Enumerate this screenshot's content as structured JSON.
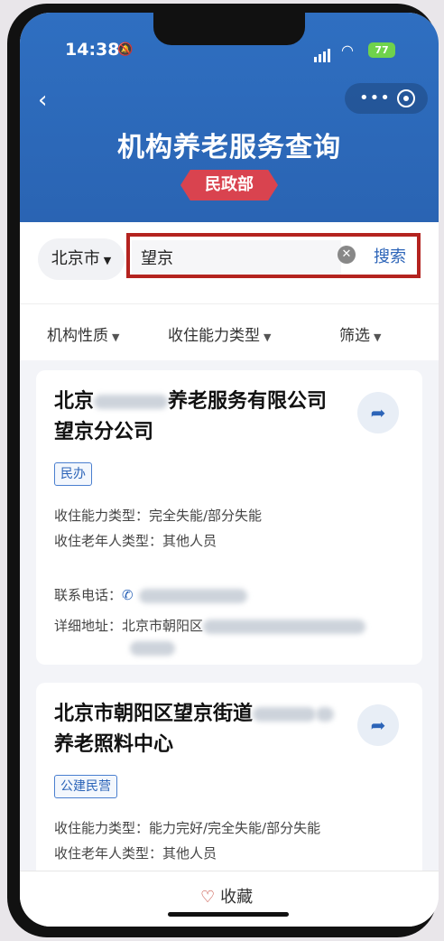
{
  "status": {
    "time": "14:38",
    "battery": "77"
  },
  "header": {
    "title": "机构养老服务查询",
    "ribbon": "民政部"
  },
  "search": {
    "city": "北京市",
    "query": "望京",
    "button": "搜索"
  },
  "filters": [
    "机构性质",
    "收住能力类型",
    "筛选"
  ],
  "cards": [
    {
      "title_prefix": "北京",
      "title_suffix": "养老服务有限公司望京分公司",
      "tag": "民办",
      "ability": "收住能力类型：完全失能/部分失能",
      "elder": "收住老年人类型：其他人员",
      "phone_label": "联系电话：",
      "address_label": "详细地址：",
      "address_prefix": "北京市朝阳区"
    },
    {
      "title_prefix": "北京市朝阳区望京街道",
      "title_suffix": "养老照料中心",
      "tag": "公建民营",
      "ability": "收住能力类型：能力完好/完全失能/部分失能",
      "elder": "收住老年人类型：其他人员"
    }
  ],
  "bottom": {
    "favorite": "收藏"
  },
  "colors": {
    "header_blue": "#2f6fc1",
    "ribbon_red": "#d9434f",
    "highlight_red": "#b4231f",
    "link_blue": "#2c64b8"
  }
}
